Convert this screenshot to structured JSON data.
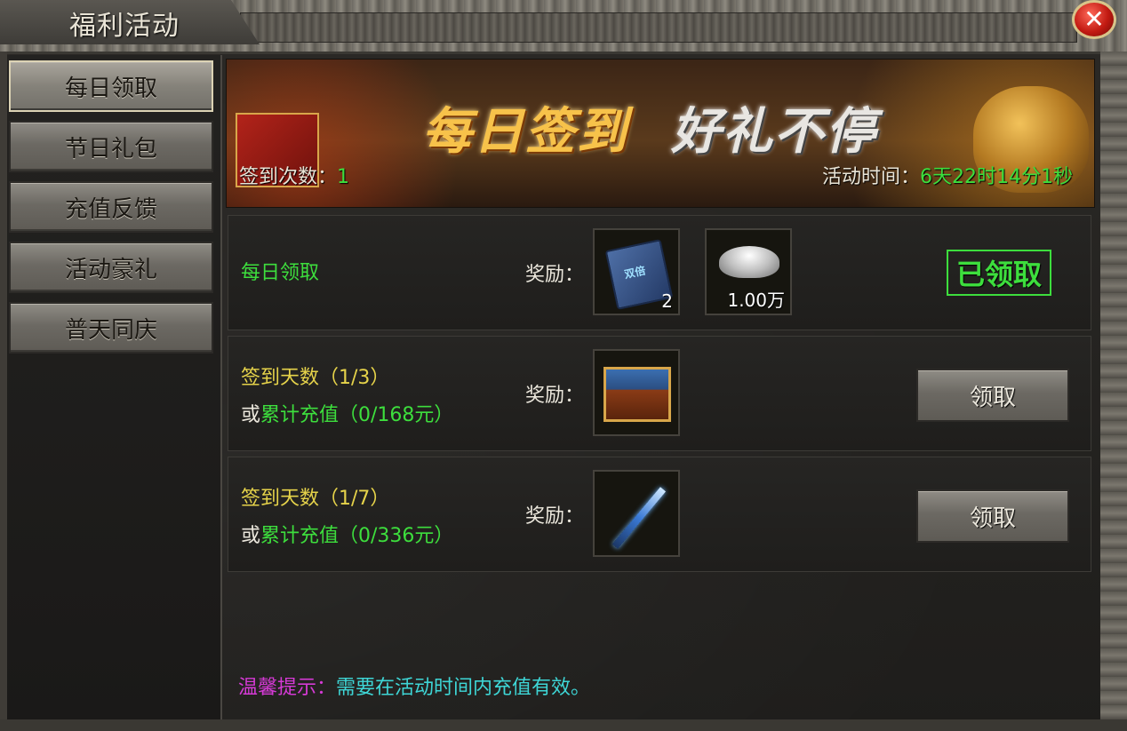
{
  "window": {
    "title": "福利活动",
    "close_glyph": "✕"
  },
  "menu": {
    "items": [
      {
        "label": "每日领取",
        "active": true
      },
      {
        "label": "节日礼包",
        "active": false
      },
      {
        "label": "充值反馈",
        "active": false
      },
      {
        "label": "活动豪礼",
        "active": false
      },
      {
        "label": "普天同庆",
        "active": false
      }
    ]
  },
  "banner": {
    "title_part1": "每日签到",
    "title_part2": "好礼不停",
    "sign_count_label": "签到次数：",
    "sign_count_value": "1",
    "activity_time_label": "活动时间：",
    "activity_time_value": "6天22时14分1秒"
  },
  "rows": [
    {
      "title": "每日领取",
      "reward_label": "奖励：",
      "rewards": [
        {
          "icon": "skill-book-icon",
          "book_glyph": "双倍",
          "qty": "2"
        },
        {
          "icon": "silver-ingot-icon",
          "qty": "1.00万"
        }
      ],
      "status": "已领取"
    },
    {
      "line1": "签到天数（1/3）",
      "line2_prefix": "或",
      "line2": "累计充值（0/168元）",
      "reward_label": "奖励：",
      "rewards": [
        {
          "icon": "treasure-chest-icon"
        }
      ],
      "button": "领取"
    },
    {
      "line1": "签到天数（1/7）",
      "line2_prefix": "或",
      "line2": "累计充值（0/336元）",
      "reward_label": "奖励：",
      "rewards": [
        {
          "icon": "magic-staff-icon"
        }
      ],
      "button": "领取"
    }
  ],
  "tip": {
    "label": "温馨提示：",
    "text": "需要在活动时间内充值有效。"
  },
  "colors": {
    "green": "#3dde3d",
    "yellow": "#e6d34a",
    "magenta": "#d63ad6",
    "cyan": "#3ed6d6"
  }
}
